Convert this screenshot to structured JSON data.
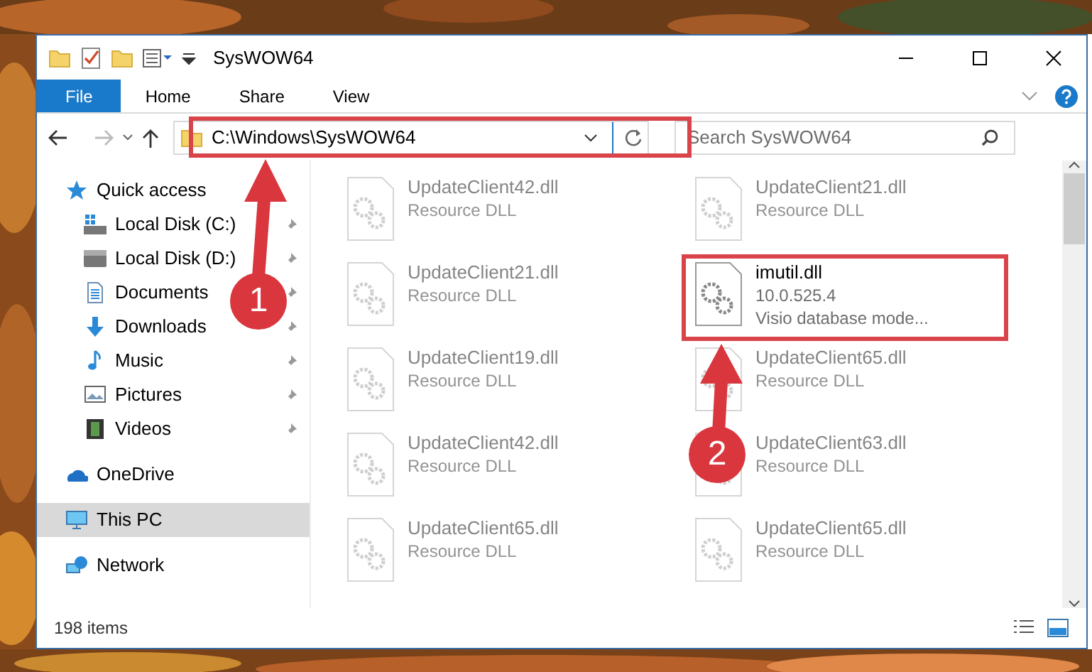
{
  "window": {
    "title": "SysWOW64"
  },
  "ribbon_tabs": [
    {
      "label": "File",
      "kind": "file",
      "selected": false
    },
    {
      "label": "Home",
      "kind": "tab",
      "selected": false
    },
    {
      "label": "Share",
      "kind": "tab",
      "selected": false
    },
    {
      "label": "View",
      "kind": "tab",
      "selected": false
    }
  ],
  "address": {
    "path": "C:\\Windows\\SysWOW64"
  },
  "search": {
    "placeholder": "Search SysWOW64"
  },
  "sidebar": {
    "items": [
      {
        "label": "Quick access",
        "kind": "star",
        "selected": false,
        "children": [
          {
            "label": "Local Disk (C:)",
            "kind": "drive-c",
            "pinned": true,
            "selected": false
          },
          {
            "label": "Local Disk (D:)",
            "kind": "drive",
            "pinned": true,
            "selected": false
          },
          {
            "label": "Documents",
            "kind": "documents",
            "pinned": true,
            "selected": false
          },
          {
            "label": "Downloads",
            "kind": "downloads",
            "pinned": true,
            "selected": false
          },
          {
            "label": "Music",
            "kind": "music",
            "pinned": true,
            "selected": false
          },
          {
            "label": "Pictures",
            "kind": "pictures",
            "pinned": true,
            "selected": false
          },
          {
            "label": "Videos",
            "kind": "videos",
            "pinned": true,
            "selected": false
          }
        ]
      },
      {
        "label": "OneDrive",
        "kind": "cloud",
        "selected": false
      },
      {
        "label": "This PC",
        "kind": "pc",
        "selected": true
      },
      {
        "label": "Network",
        "kind": "network",
        "selected": false
      }
    ]
  },
  "files": [
    {
      "name": "UpdateClient42.dll",
      "details": [
        "Resource DLL"
      ],
      "dimmed": true
    },
    {
      "name": "UpdateClient21.dll",
      "details": [
        "Resource DLL"
      ],
      "dimmed": true
    },
    {
      "name": "UpdateClient21.dll",
      "details": [
        "Resource DLL"
      ],
      "dimmed": true
    },
    {
      "name": "imutil.dll",
      "details": [
        "10.0.525.4",
        "Visio database mode..."
      ],
      "dimmed": false
    },
    {
      "name": "UpdateClient19.dll",
      "details": [
        "Resource DLL"
      ],
      "dimmed": true
    },
    {
      "name": "UpdateClient65.dll",
      "details": [
        "Resource DLL"
      ],
      "dimmed": true
    },
    {
      "name": "UpdateClient42.dll",
      "details": [
        "Resource DLL"
      ],
      "dimmed": true
    },
    {
      "name": "UpdateClient63.dll",
      "details": [
        "Resource DLL"
      ],
      "dimmed": true
    },
    {
      "name": "UpdateClient65.dll",
      "details": [
        "Resource DLL"
      ],
      "dimmed": true
    },
    {
      "name": "UpdateClient65.dll",
      "details": [
        "Resource DLL"
      ],
      "dimmed": true
    }
  ],
  "status_bar": {
    "count": "198 items"
  },
  "annotations": [
    {
      "label": "1"
    },
    {
      "label": "2"
    }
  ]
}
